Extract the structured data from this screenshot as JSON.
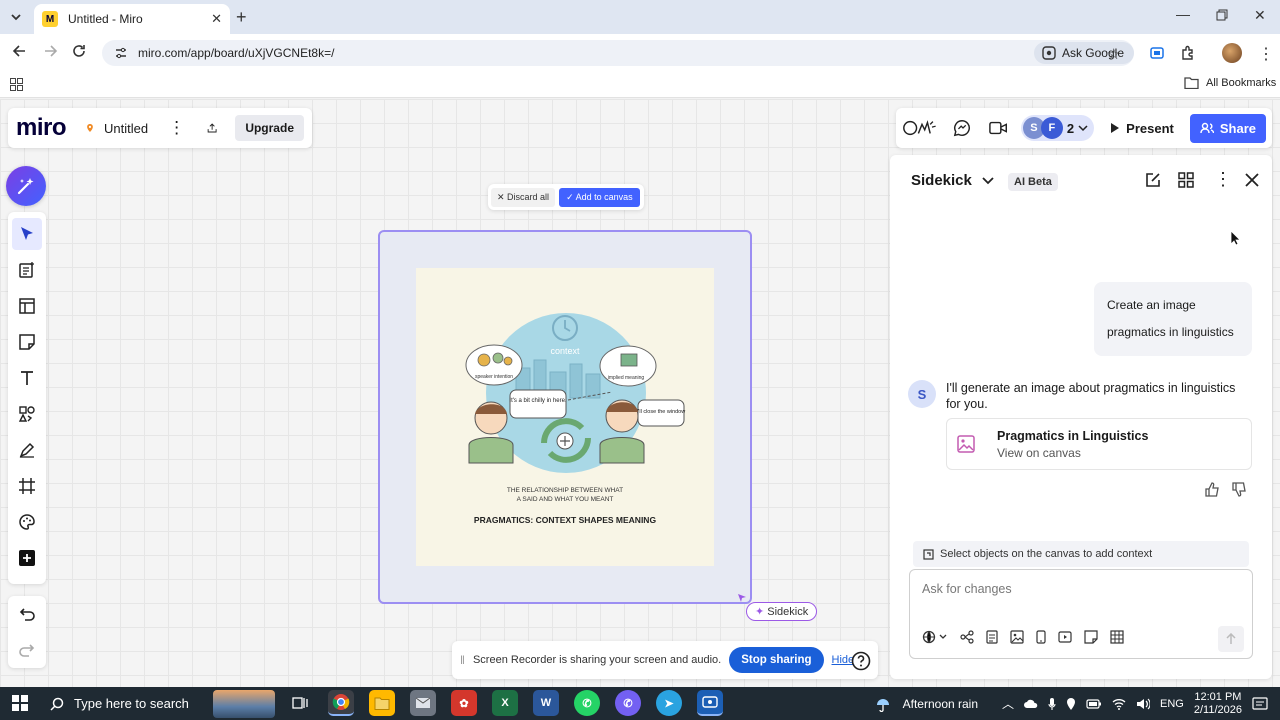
{
  "browser": {
    "tab_title": "Untitled - Miro",
    "url": "miro.com/app/board/uXjVGCNEt8k=/",
    "ask_google": "Ask Google",
    "all_bookmarks": "All Bookmarks"
  },
  "board": {
    "logo": "miro",
    "name": "Untitled",
    "upgrade": "Upgrade",
    "collaborators_count": "2",
    "avatars": [
      {
        "initial": "S",
        "color": "#7b8fd1"
      },
      {
        "initial": "F",
        "color": "#3b5bd6"
      }
    ],
    "present": "Present",
    "share": "Share"
  },
  "generated_image": {
    "discard_all": "Discard all",
    "add_to_canvas": "Add to canvas",
    "context_label": "context",
    "speaker_intention": "speaker intention",
    "implied_meaning": "implied meaning",
    "bubble_left": "It's a bit chilly in here.",
    "bubble_right": "I'll close the window",
    "relationship_line1": "THE RELATIONSHIP BETWEEN WHAT",
    "relationship_line2": "A SAID AND WHAT YOU MEANT",
    "headline": "PRAGMATICS: CONTEXT SHAPES MEANING",
    "tag": "Sidekick"
  },
  "sidekick": {
    "title": "Sidekick",
    "badge": "AI Beta",
    "user_message": "Create an image pragmatics in linguistics",
    "bot_initial": "S",
    "bot_message": "I'll generate an image about pragmatics in linguistics for you.",
    "card_title": "Pragmatics in Linguistics",
    "card_link": "View on canvas",
    "context_hint": "Select objects on the canvas to add context",
    "input_placeholder": "Ask for changes"
  },
  "recorder": {
    "message": "Screen Recorder is sharing your screen and audio.",
    "stop": "Stop sharing",
    "hide": "Hide"
  },
  "taskbar": {
    "search_placeholder": "Type here to search",
    "weather": "Afternoon rain",
    "language": "ENG",
    "time": "12:01 PM",
    "date": "2/11/2026"
  },
  "colors": {
    "accent": "#4262ff",
    "miro_yellow": "#ffd02f",
    "frame_border": "#9c8ef2"
  }
}
